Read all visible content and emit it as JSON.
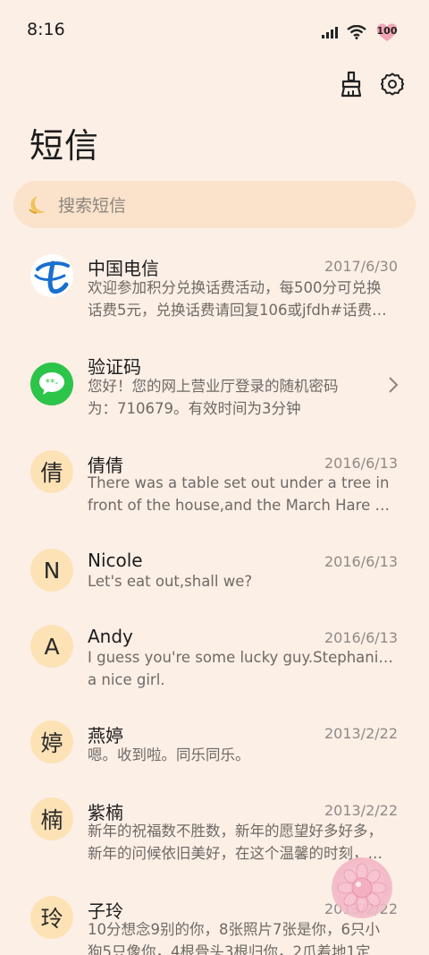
{
  "status_bar": {
    "time": "8:16",
    "battery": "100"
  },
  "header": {
    "title": "短信"
  },
  "search": {
    "placeholder": "搜索短信"
  },
  "colors": {
    "background": "#fcefe6",
    "search_bg": "#fbe3cb",
    "avatar_bg": "#fde2b6",
    "brand_blue": "#1a6fd0",
    "wechat_green": "#2dc44a"
  },
  "conversations": [
    {
      "name": "中国电信",
      "date": "2017/6/30",
      "avatar": "telecom-logo",
      "preview": [
        "欢迎参加积分兑换话费活动，每500分可兑换",
        "话费5元，兑换话费请回复106或jfdh#话费…"
      ]
    },
    {
      "name": "验证码",
      "date": "",
      "avatar": "message-icon",
      "preview": [
        "您好！您的网上营业厅登录的随机密码",
        "为：710679。有效时间为3分钟"
      ]
    },
    {
      "name": "倩倩",
      "date": "2016/6/13",
      "avatar": "倩",
      "preview": [
        "There was a table set out under a tree in",
        "front of the house,and the March Hare an…"
      ]
    },
    {
      "name": "Nicole",
      "date": "2016/6/13",
      "avatar": "N",
      "preview": [
        "Let's eat out,shall we?"
      ]
    },
    {
      "name": "Andy",
      "date": "2016/6/13",
      "avatar": "A",
      "preview": [
        "I guess you're some lucky guy.Stephanie is",
        "a nice girl."
      ]
    },
    {
      "name": "燕婷",
      "date": "2013/2/22",
      "avatar": "婷",
      "preview": [
        "嗯。收到啦。同乐同乐。"
      ]
    },
    {
      "name": "紫楠",
      "date": "2013/2/22",
      "avatar": "楠",
      "preview": [
        "新年的祝福数不胜数，新年的愿望好多好多，",
        "新年的问候依旧美好，在这个温馨的时刻，…"
      ]
    },
    {
      "name": "子玲",
      "date": "2013/2/22",
      "avatar": "玲",
      "preview": [
        "10分想念9别的你，8张照片7张是你，6只小",
        "狗5只像你，4根骨头3根归你，2爪着地1定"
      ]
    }
  ]
}
